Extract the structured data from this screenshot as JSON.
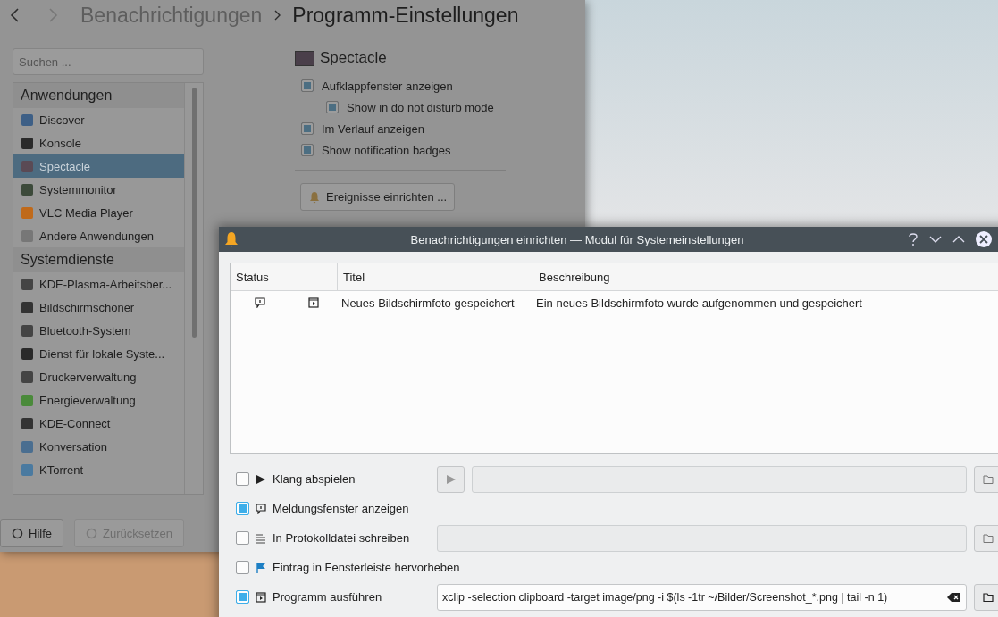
{
  "breadcrumb": [
    {
      "label": "Benachrichtigungen",
      "current": false
    },
    {
      "label": "Programm-Einstellungen",
      "current": true
    }
  ],
  "search": {
    "placeholder": "Suchen ..."
  },
  "sidebar": {
    "groups": [
      {
        "title": "Anwendungen",
        "items": [
          {
            "label": "Discover",
            "selected": false
          },
          {
            "label": "Konsole",
            "selected": false
          },
          {
            "label": "Spectacle",
            "selected": true
          },
          {
            "label": "Systemmonitor",
            "selected": false
          },
          {
            "label": "VLC Media Player",
            "selected": false
          },
          {
            "label": "Andere Anwendungen",
            "selected": false
          }
        ]
      },
      {
        "title": "Systemdienste",
        "items": [
          {
            "label": "KDE-Plasma-Arbeitsber...",
            "selected": false
          },
          {
            "label": "Bildschirmschoner",
            "selected": false
          },
          {
            "label": "Bluetooth-System",
            "selected": false
          },
          {
            "label": "Dienst für lokale Syste...",
            "selected": false
          },
          {
            "label": "Druckerverwaltung",
            "selected": false
          },
          {
            "label": "Energieverwaltung",
            "selected": false
          },
          {
            "label": "KDE-Connect",
            "selected": false
          },
          {
            "label": "Konversation",
            "selected": false
          },
          {
            "label": "KTorrent",
            "selected": false
          }
        ]
      }
    ]
  },
  "app": {
    "title": "Spectacle",
    "options": [
      {
        "label": "Aufklappfenster anzeigen",
        "checked": true,
        "children": [
          {
            "label": "Show in do not disturb mode",
            "checked": true
          }
        ]
      },
      {
        "label": "Im Verlauf anzeigen",
        "checked": true
      },
      {
        "label": "Show notification badges",
        "checked": true
      }
    ],
    "button": "Ereignisse einrichten ..."
  },
  "footer_buttons": [
    {
      "label": "Hilfe",
      "disabled": false
    },
    {
      "label": "Zurücksetzen",
      "disabled": true
    }
  ],
  "dialog": {
    "title": "Benachrichtigungen einrichten — Modul für Systemeinstellungen",
    "table": {
      "columns": [
        "Status",
        "Titel",
        "Beschreibung"
      ],
      "rows": [
        {
          "title": "Neues Bildschirmfoto gespeichert",
          "description": "Ein neues Bildschirmfoto wurde aufgenommen und gespeichert"
        }
      ]
    },
    "actions": [
      {
        "kind": "sound",
        "label": "Klang abspielen",
        "checked": false
      },
      {
        "kind": "popup",
        "label": "Meldungsfenster anzeigen",
        "checked": true
      },
      {
        "kind": "log",
        "label": "In Protokolldatei schreiben",
        "checked": false
      },
      {
        "kind": "taskbar",
        "label": "Eintrag in Fensterleiste hervorheben",
        "checked": false
      },
      {
        "kind": "command",
        "label": "Programm ausführen",
        "checked": true,
        "value": "xclip -selection clipboard -target image/png -i $(ls -1tr ~/Bilder/Screenshot_*.png | tail -n 1)"
      }
    ]
  }
}
